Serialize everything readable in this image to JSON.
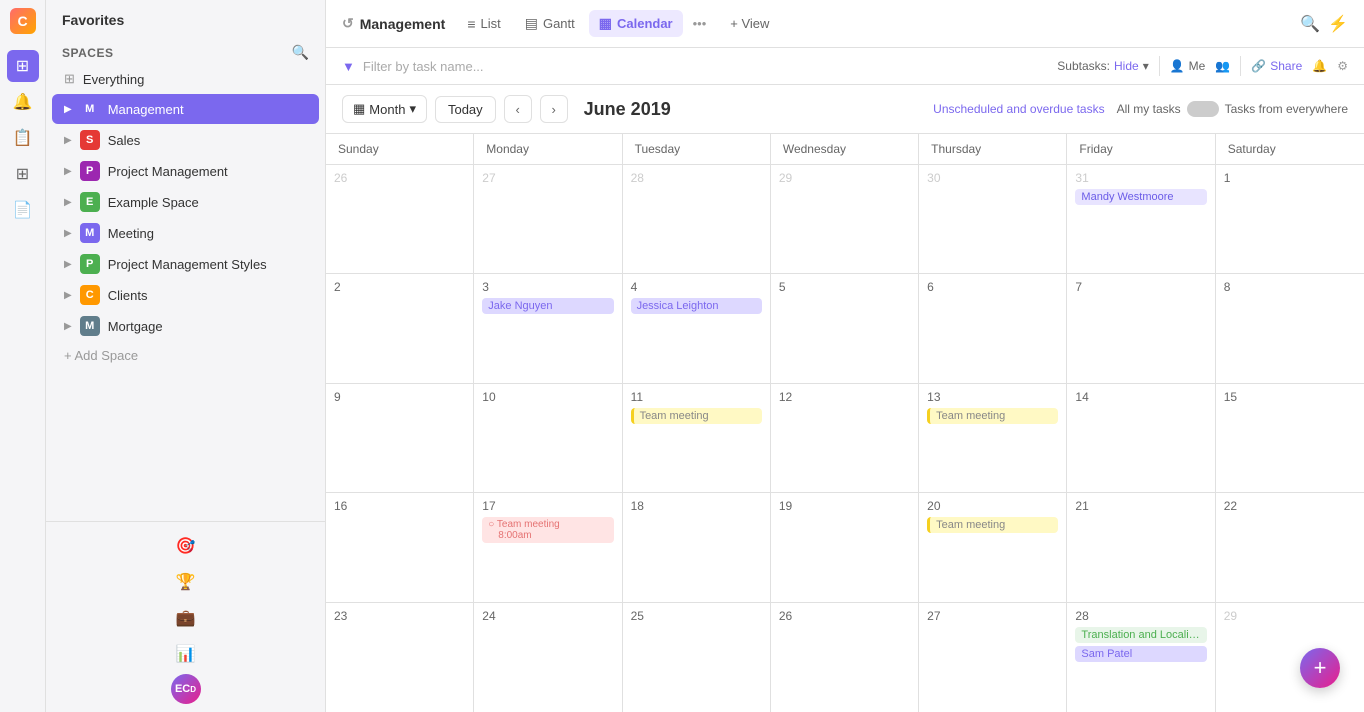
{
  "app": {
    "logo": "C",
    "favorites_title": "Favorites",
    "spaces_label": "Spaces"
  },
  "sidebar": {
    "everything_label": "Everything",
    "items": [
      {
        "id": "management",
        "label": "Management",
        "color": "#7b68ee",
        "letter": "M",
        "active": true
      },
      {
        "id": "sales",
        "label": "Sales",
        "color": "#e53935",
        "letter": "S",
        "active": false
      },
      {
        "id": "project-management",
        "label": "Project Management",
        "color": "#9c27b0",
        "letter": "P",
        "active": false
      },
      {
        "id": "example-space",
        "label": "Example Space",
        "color": "#4caf50",
        "letter": "E",
        "active": false
      },
      {
        "id": "meeting",
        "label": "Meeting",
        "color": "#7b68ee",
        "letter": "M",
        "active": false
      },
      {
        "id": "project-management-styles",
        "label": "Project Management Styles",
        "color": "#4caf50",
        "letter": "P",
        "active": false
      },
      {
        "id": "clients",
        "label": "Clients",
        "color": "#ff9800",
        "letter": "C",
        "active": false
      },
      {
        "id": "mortgage",
        "label": "Mortgage",
        "color": "#607d8b",
        "letter": "M",
        "active": false
      }
    ],
    "add_space_label": "+ Add Space"
  },
  "left_nav": {
    "icons": [
      "⊞",
      "🔔",
      "📋",
      "⊞",
      "📄"
    ]
  },
  "topbar": {
    "title": "Management",
    "title_icon": "↺",
    "tabs": [
      {
        "id": "list",
        "label": "List",
        "icon": "≡",
        "active": false
      },
      {
        "id": "gantt",
        "label": "Gantt",
        "icon": "▤",
        "active": false
      },
      {
        "id": "calendar",
        "label": "Calendar",
        "icon": "▦",
        "active": true
      }
    ],
    "more_label": "•••",
    "view_label": "+ View",
    "search_icon": "🔍",
    "bolt_icon": "⚡"
  },
  "filterbar": {
    "filter_icon": "▼",
    "filter_label": "▼",
    "placeholder": "Filter by task name...",
    "subtasks_label": "Subtasks:",
    "hide_label": "Hide",
    "hide_arrow": "▾",
    "me_label": "Me",
    "me_icon": "👤",
    "share_label": "Share",
    "share_icon": "🔗",
    "settings_icon": "⚙",
    "bell_icon": "🔔"
  },
  "calendar": {
    "month_label": "Month",
    "today_label": "Today",
    "title": "June 2019",
    "unscheduled_label": "Unscheduled and overdue tasks",
    "all_my_tasks_label": "All my tasks",
    "tasks_from_label": "Tasks from everywhere",
    "day_headers": [
      "Sunday",
      "Monday",
      "Tuesday",
      "Wednesday",
      "Thursday",
      "Friday",
      "Saturday"
    ],
    "weeks": [
      {
        "days": [
          {
            "date": "26",
            "other_month": true,
            "events": []
          },
          {
            "date": "27",
            "other_month": true,
            "events": []
          },
          {
            "date": "28",
            "other_month": true,
            "events": []
          },
          {
            "date": "29",
            "other_month": true,
            "events": []
          },
          {
            "date": "30",
            "other_month": true,
            "events": []
          },
          {
            "date": "31",
            "other_month": true,
            "events": [
              {
                "label": "Mandy Westmoore",
                "type": "event-purple"
              }
            ]
          },
          {
            "date": "1",
            "other_month": false,
            "events": []
          }
        ]
      },
      {
        "days": [
          {
            "date": "2",
            "other_month": false,
            "events": []
          },
          {
            "date": "3",
            "other_month": false,
            "events": [
              {
                "label": "Jake Nguyen",
                "type": "event-lavender"
              }
            ]
          },
          {
            "date": "4",
            "other_month": false,
            "events": [
              {
                "label": "Jessica Leighton",
                "type": "event-lavender"
              }
            ]
          },
          {
            "date": "5",
            "other_month": false,
            "events": []
          },
          {
            "date": "6",
            "other_month": false,
            "events": []
          },
          {
            "date": "7",
            "other_month": false,
            "events": []
          },
          {
            "date": "8",
            "other_month": false,
            "events": []
          }
        ]
      },
      {
        "days": [
          {
            "date": "9",
            "other_month": false,
            "events": []
          },
          {
            "date": "10",
            "other_month": false,
            "events": []
          },
          {
            "date": "11",
            "other_month": false,
            "events": [
              {
                "label": "Team meeting",
                "type": "event-yellow"
              }
            ]
          },
          {
            "date": "12",
            "other_month": false,
            "events": []
          },
          {
            "date": "13",
            "other_month": false,
            "events": [
              {
                "label": "Team meeting",
                "type": "event-yellow"
              }
            ]
          },
          {
            "date": "14",
            "other_month": false,
            "events": []
          },
          {
            "date": "15",
            "other_month": false,
            "events": []
          }
        ]
      },
      {
        "days": [
          {
            "date": "16",
            "other_month": false,
            "events": []
          },
          {
            "date": "17",
            "other_month": false,
            "events": [
              {
                "label": "Team meeting",
                "type": "event-pink",
                "time": "8:00am"
              }
            ]
          },
          {
            "date": "18",
            "other_month": false,
            "events": []
          },
          {
            "date": "19",
            "other_month": false,
            "events": []
          },
          {
            "date": "20",
            "other_month": false,
            "events": [
              {
                "label": "Team meeting",
                "type": "event-yellow"
              }
            ]
          },
          {
            "date": "21",
            "other_month": false,
            "events": []
          },
          {
            "date": "22",
            "other_month": false,
            "events": []
          }
        ]
      },
      {
        "days": [
          {
            "date": "23",
            "other_month": false,
            "events": []
          },
          {
            "date": "24",
            "other_month": false,
            "events": []
          },
          {
            "date": "25",
            "other_month": false,
            "events": []
          },
          {
            "date": "26",
            "other_month": false,
            "events": []
          },
          {
            "date": "27",
            "other_month": false,
            "events": []
          },
          {
            "date": "28",
            "other_month": false,
            "events": [
              {
                "label": "Translation and Localization",
                "type": "event-green"
              },
              {
                "label": "Sam Patel",
                "type": "event-lavender"
              }
            ]
          },
          {
            "date": "29",
            "other_month": true,
            "events": []
          }
        ]
      }
    ]
  },
  "fab": {
    "label": "+"
  }
}
